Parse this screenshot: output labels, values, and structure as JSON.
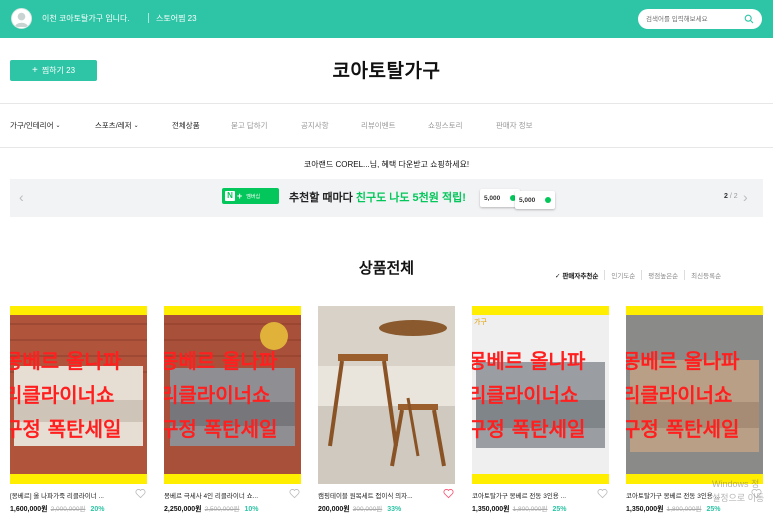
{
  "topbar": {
    "store_name": "이천 코아토탈가구 입니다.",
    "store_fav": "스토어찜 23",
    "search_placeholder": "검색어를 입력해보세요"
  },
  "header": {
    "fav_button": "찜하기 23",
    "logo": "코아토탈가구"
  },
  "nav": {
    "items": [
      {
        "label": "가구/인테리어",
        "dropdown": true
      },
      {
        "label": "스포츠/레저",
        "dropdown": true
      },
      {
        "label": "전체상품"
      },
      {
        "label": "묻고 답하기"
      },
      {
        "label": "공지사항"
      },
      {
        "label": "리뷰이벤트"
      },
      {
        "label": "쇼핑스토리"
      },
      {
        "label": "판매자 정보"
      }
    ]
  },
  "welcome": "코아랜드 COREL...님, 혜택 다운받고 쇼핑하세요!",
  "banner": {
    "npay_label": "멤버십",
    "text_prefix": "추천할 때마다 ",
    "text_highlight": "친구도 나도 5천원 적립!",
    "coupon1": "5,000",
    "coupon2": "5,000",
    "page_current": "2",
    "page_total": "/ 2"
  },
  "section": {
    "title": "상품전체",
    "sort": [
      "판매자추천순",
      "인기도순",
      "평점높은순",
      "최신등록순"
    ],
    "sort_active": 0
  },
  "products": [
    {
      "name": "[몽베르] 올 나파가죽 리클라이너 ...",
      "price": "1,600,000원",
      "old": "2,000,000원",
      "discount": "20%",
      "liked": false
    },
    {
      "name": "몽베르 극세사 4인 리클라이너 쇼...",
      "price": "2,250,000원",
      "old": "2,500,000원",
      "discount": "10%",
      "liked": false
    },
    {
      "name": "캠핑테이블 원목세트 접이식 의자...",
      "price": "200,000원",
      "old": "300,000원",
      "discount": "33%",
      "liked": true
    },
    {
      "name": "코아토탈가구 몽베르 전동 3인용 ...",
      "price": "1,350,000원",
      "old": "1,800,000원",
      "discount": "25%",
      "liked": false
    },
    {
      "name": "코아토탈가구 몽베르 전동 3인용 ...",
      "price": "1,350,000원",
      "old": "1,800,000원",
      "discount": "25%",
      "liked": false
    }
  ],
  "overlay_text": {
    "line1": "몽베르 올나파",
    "line2": "리클라이너쇼",
    "line3": "구정 폭탄세일",
    "corner_tag": "가구"
  },
  "watermark": [
    "Windows 정",
    "설정으로 이동"
  ],
  "colors": {
    "accent": "#2ec4a6",
    "naver_green": "#03c75a",
    "promo_red": "#ff1f1f",
    "promo_yellow": "#ffee00"
  }
}
